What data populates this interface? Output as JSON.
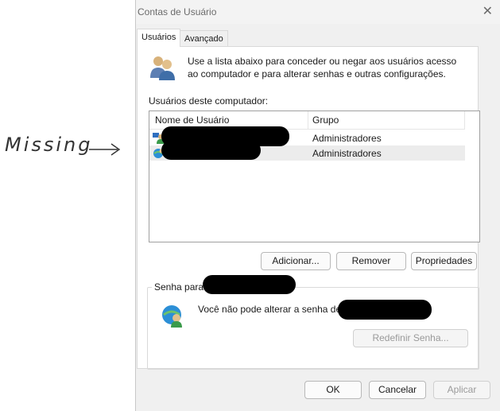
{
  "annotation": {
    "text": "Missing"
  },
  "window": {
    "title": "Contas de Usuário",
    "close_glyph": "✕"
  },
  "tabs": [
    {
      "label": "Usuários",
      "active": true
    },
    {
      "label": "Avançado",
      "active": false
    }
  ],
  "intro": {
    "icon": "users-icon",
    "text": "Use a lista abaixo para conceder ou negar aos usuários acesso ao computador e para alterar senhas e outras configurações."
  },
  "users_list": {
    "label": "Usuários deste computador:",
    "columns": [
      "Nome de Usuário",
      "Grupo"
    ],
    "rows": [
      {
        "group": "Administradores",
        "icon": "user-icon"
      },
      {
        "group": "Administradores",
        "icon": "user-globe-icon"
      }
    ]
  },
  "list_buttons": {
    "add": "Adicionar...",
    "remove": "Remover",
    "properties": "Propriedades"
  },
  "password_group": {
    "label": "Senha para",
    "message": "Você não pode alterar a senha de",
    "reset_button": "Redefinir Senha..."
  },
  "footer_buttons": {
    "ok": "OK",
    "cancel": "Cancelar",
    "apply": "Aplicar"
  },
  "colors": {
    "dialog_bg": "#f0f0f0",
    "panel_bg": "#ffffff",
    "selected_row": "#ececec",
    "redaction": "#000000"
  }
}
